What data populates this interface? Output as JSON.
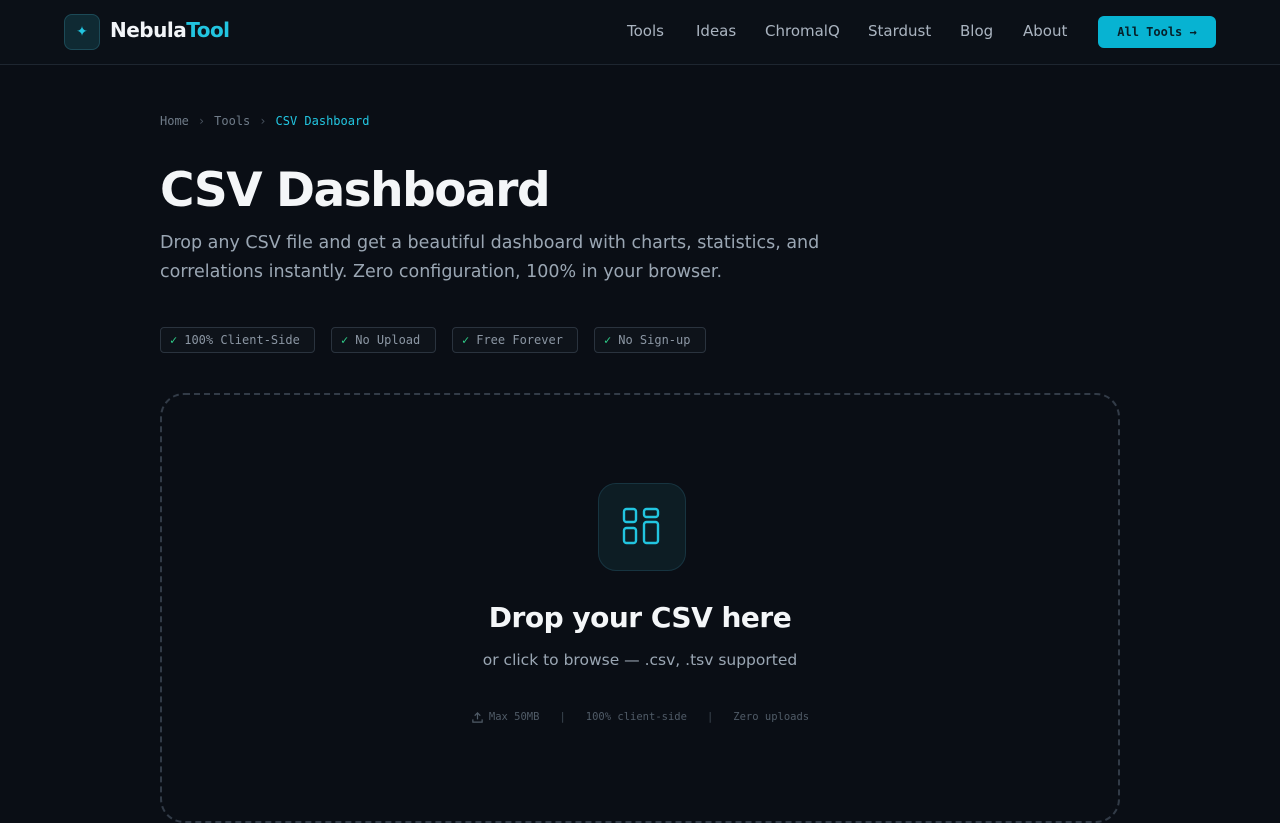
{
  "header": {
    "logo_icon": "sparkle-icon",
    "logo_part1": "Nebula",
    "logo_part2": "Tool",
    "nav": [
      "Tools",
      "Ideas",
      "ChromalQ",
      "Stardust",
      "Blog",
      "About"
    ],
    "cta_label": "All Tools →"
  },
  "breadcrumb": {
    "items": [
      "Home",
      "Tools"
    ],
    "current": "CSV Dashboard"
  },
  "page": {
    "title": "CSV Dashboard",
    "subtitle": "Drop any CSV file and get a beautiful dashboard with charts, statistics, and correlations instantly. Zero configuration, 100% in your browser."
  },
  "badges": [
    "100% Client-Side",
    "No Upload",
    "Free Forever",
    "No Sign-up"
  ],
  "dropzone": {
    "icon": "dashboard-layout-icon",
    "title": "Drop your CSV here",
    "subtitle": "or click to browse — .csv, .tsv supported",
    "meta": [
      "Max 50MB",
      "100% client-side",
      "Zero uploads"
    ],
    "separator": "|"
  },
  "colors": {
    "accent": "#22c5e0",
    "cta_bg": "#07b3d2",
    "background": "#0a0e15",
    "check": "#2fcf8a"
  }
}
